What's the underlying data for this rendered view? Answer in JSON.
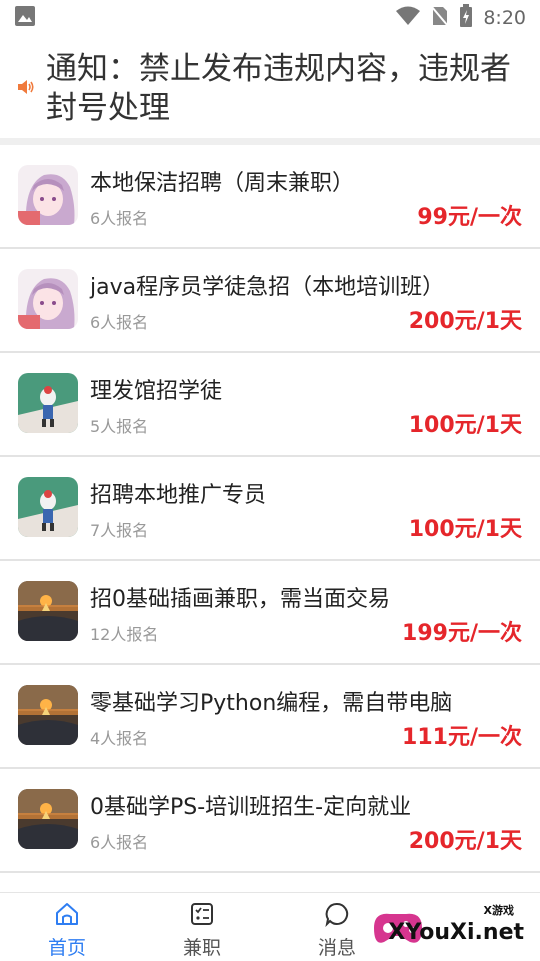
{
  "status_bar": {
    "time": "8:20"
  },
  "notice": {
    "text": "通知：禁止发布违规内容，违规者封号处理"
  },
  "jobs": [
    {
      "title": "本地保洁招聘（周末兼职）",
      "count": "6人报名",
      "price": "99元/一次",
      "thumb": "anime-avatar"
    },
    {
      "title": "java程序员学徒急招（本地培训班）",
      "count": "6人报名",
      "price": "200元/1天",
      "thumb": "anime-avatar"
    },
    {
      "title": "理发馆招学徒",
      "count": "5人报名",
      "price": "100元/1天",
      "thumb": "green-cartoon"
    },
    {
      "title": "招聘本地推广专员",
      "count": "7人报名",
      "price": "100元/1天",
      "thumb": "green-cartoon"
    },
    {
      "title": "招0基础插画兼职，需当面交易",
      "count": "12人报名",
      "price": "199元/一次",
      "thumb": "sunset-photo"
    },
    {
      "title": "零基础学习Python编程，需自带电脑",
      "count": "4人报名",
      "price": "111元/一次",
      "thumb": "sunset-photo"
    },
    {
      "title": "0基础学PS-培训班招生-定向就业",
      "count": "6人报名",
      "price": "200元/1天",
      "thumb": "sunset-photo"
    }
  ],
  "tabs": [
    {
      "label": "首页",
      "icon": "home-icon",
      "active": true
    },
    {
      "label": "兼职",
      "icon": "checklist-icon",
      "active": false
    },
    {
      "label": "消息",
      "icon": "chat-bubble-icon",
      "active": false
    }
  ],
  "watermark": {
    "small": "X游戏",
    "big": "XYouXi.net"
  },
  "colors": {
    "accent": "#2f7ef2",
    "price": "#e5262b",
    "muted": "#999999"
  }
}
